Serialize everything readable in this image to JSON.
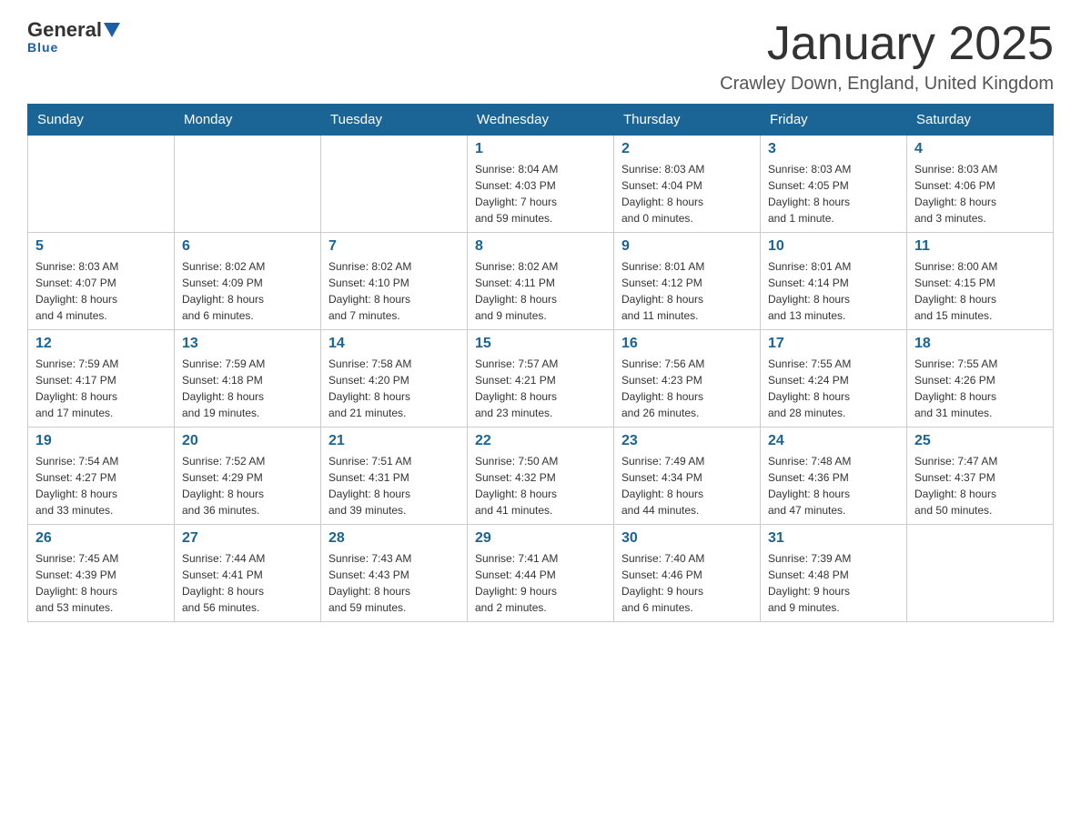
{
  "header": {
    "logo_general": "General",
    "logo_blue": "Blue",
    "month_title": "January 2025",
    "location": "Crawley Down, England, United Kingdom"
  },
  "days_of_week": [
    "Sunday",
    "Monday",
    "Tuesday",
    "Wednesday",
    "Thursday",
    "Friday",
    "Saturday"
  ],
  "weeks": [
    [
      {
        "day": "",
        "info": ""
      },
      {
        "day": "",
        "info": ""
      },
      {
        "day": "",
        "info": ""
      },
      {
        "day": "1",
        "info": "Sunrise: 8:04 AM\nSunset: 4:03 PM\nDaylight: 7 hours\nand 59 minutes."
      },
      {
        "day": "2",
        "info": "Sunrise: 8:03 AM\nSunset: 4:04 PM\nDaylight: 8 hours\nand 0 minutes."
      },
      {
        "day": "3",
        "info": "Sunrise: 8:03 AM\nSunset: 4:05 PM\nDaylight: 8 hours\nand 1 minute."
      },
      {
        "day": "4",
        "info": "Sunrise: 8:03 AM\nSunset: 4:06 PM\nDaylight: 8 hours\nand 3 minutes."
      }
    ],
    [
      {
        "day": "5",
        "info": "Sunrise: 8:03 AM\nSunset: 4:07 PM\nDaylight: 8 hours\nand 4 minutes."
      },
      {
        "day": "6",
        "info": "Sunrise: 8:02 AM\nSunset: 4:09 PM\nDaylight: 8 hours\nand 6 minutes."
      },
      {
        "day": "7",
        "info": "Sunrise: 8:02 AM\nSunset: 4:10 PM\nDaylight: 8 hours\nand 7 minutes."
      },
      {
        "day": "8",
        "info": "Sunrise: 8:02 AM\nSunset: 4:11 PM\nDaylight: 8 hours\nand 9 minutes."
      },
      {
        "day": "9",
        "info": "Sunrise: 8:01 AM\nSunset: 4:12 PM\nDaylight: 8 hours\nand 11 minutes."
      },
      {
        "day": "10",
        "info": "Sunrise: 8:01 AM\nSunset: 4:14 PM\nDaylight: 8 hours\nand 13 minutes."
      },
      {
        "day": "11",
        "info": "Sunrise: 8:00 AM\nSunset: 4:15 PM\nDaylight: 8 hours\nand 15 minutes."
      }
    ],
    [
      {
        "day": "12",
        "info": "Sunrise: 7:59 AM\nSunset: 4:17 PM\nDaylight: 8 hours\nand 17 minutes."
      },
      {
        "day": "13",
        "info": "Sunrise: 7:59 AM\nSunset: 4:18 PM\nDaylight: 8 hours\nand 19 minutes."
      },
      {
        "day": "14",
        "info": "Sunrise: 7:58 AM\nSunset: 4:20 PM\nDaylight: 8 hours\nand 21 minutes."
      },
      {
        "day": "15",
        "info": "Sunrise: 7:57 AM\nSunset: 4:21 PM\nDaylight: 8 hours\nand 23 minutes."
      },
      {
        "day": "16",
        "info": "Sunrise: 7:56 AM\nSunset: 4:23 PM\nDaylight: 8 hours\nand 26 minutes."
      },
      {
        "day": "17",
        "info": "Sunrise: 7:55 AM\nSunset: 4:24 PM\nDaylight: 8 hours\nand 28 minutes."
      },
      {
        "day": "18",
        "info": "Sunrise: 7:55 AM\nSunset: 4:26 PM\nDaylight: 8 hours\nand 31 minutes."
      }
    ],
    [
      {
        "day": "19",
        "info": "Sunrise: 7:54 AM\nSunset: 4:27 PM\nDaylight: 8 hours\nand 33 minutes."
      },
      {
        "day": "20",
        "info": "Sunrise: 7:52 AM\nSunset: 4:29 PM\nDaylight: 8 hours\nand 36 minutes."
      },
      {
        "day": "21",
        "info": "Sunrise: 7:51 AM\nSunset: 4:31 PM\nDaylight: 8 hours\nand 39 minutes."
      },
      {
        "day": "22",
        "info": "Sunrise: 7:50 AM\nSunset: 4:32 PM\nDaylight: 8 hours\nand 41 minutes."
      },
      {
        "day": "23",
        "info": "Sunrise: 7:49 AM\nSunset: 4:34 PM\nDaylight: 8 hours\nand 44 minutes."
      },
      {
        "day": "24",
        "info": "Sunrise: 7:48 AM\nSunset: 4:36 PM\nDaylight: 8 hours\nand 47 minutes."
      },
      {
        "day": "25",
        "info": "Sunrise: 7:47 AM\nSunset: 4:37 PM\nDaylight: 8 hours\nand 50 minutes."
      }
    ],
    [
      {
        "day": "26",
        "info": "Sunrise: 7:45 AM\nSunset: 4:39 PM\nDaylight: 8 hours\nand 53 minutes."
      },
      {
        "day": "27",
        "info": "Sunrise: 7:44 AM\nSunset: 4:41 PM\nDaylight: 8 hours\nand 56 minutes."
      },
      {
        "day": "28",
        "info": "Sunrise: 7:43 AM\nSunset: 4:43 PM\nDaylight: 8 hours\nand 59 minutes."
      },
      {
        "day": "29",
        "info": "Sunrise: 7:41 AM\nSunset: 4:44 PM\nDaylight: 9 hours\nand 2 minutes."
      },
      {
        "day": "30",
        "info": "Sunrise: 7:40 AM\nSunset: 4:46 PM\nDaylight: 9 hours\nand 6 minutes."
      },
      {
        "day": "31",
        "info": "Sunrise: 7:39 AM\nSunset: 4:48 PM\nDaylight: 9 hours\nand 9 minutes."
      },
      {
        "day": "",
        "info": ""
      }
    ]
  ]
}
